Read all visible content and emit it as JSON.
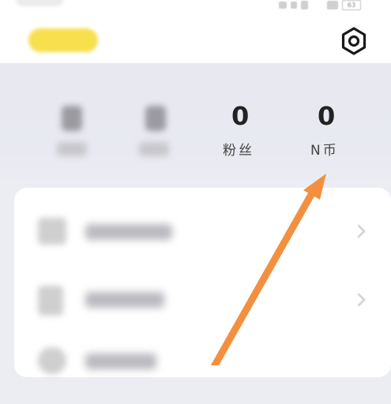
{
  "status_bar": {
    "battery": "63"
  },
  "stats": [
    {
      "value": "",
      "label": ""
    },
    {
      "value": "",
      "label": ""
    },
    {
      "value": "0",
      "label": "粉丝"
    },
    {
      "value": "0",
      "label": "N币"
    }
  ],
  "menu_items": [
    {
      "label": ""
    },
    {
      "label": ""
    },
    {
      "label": ""
    }
  ],
  "icons": {
    "settings": "settings-icon",
    "chevron": "chevron-right-icon"
  },
  "colors": {
    "vip_badge": "#f7df4d",
    "annotation_arrow": "#f3903f"
  }
}
